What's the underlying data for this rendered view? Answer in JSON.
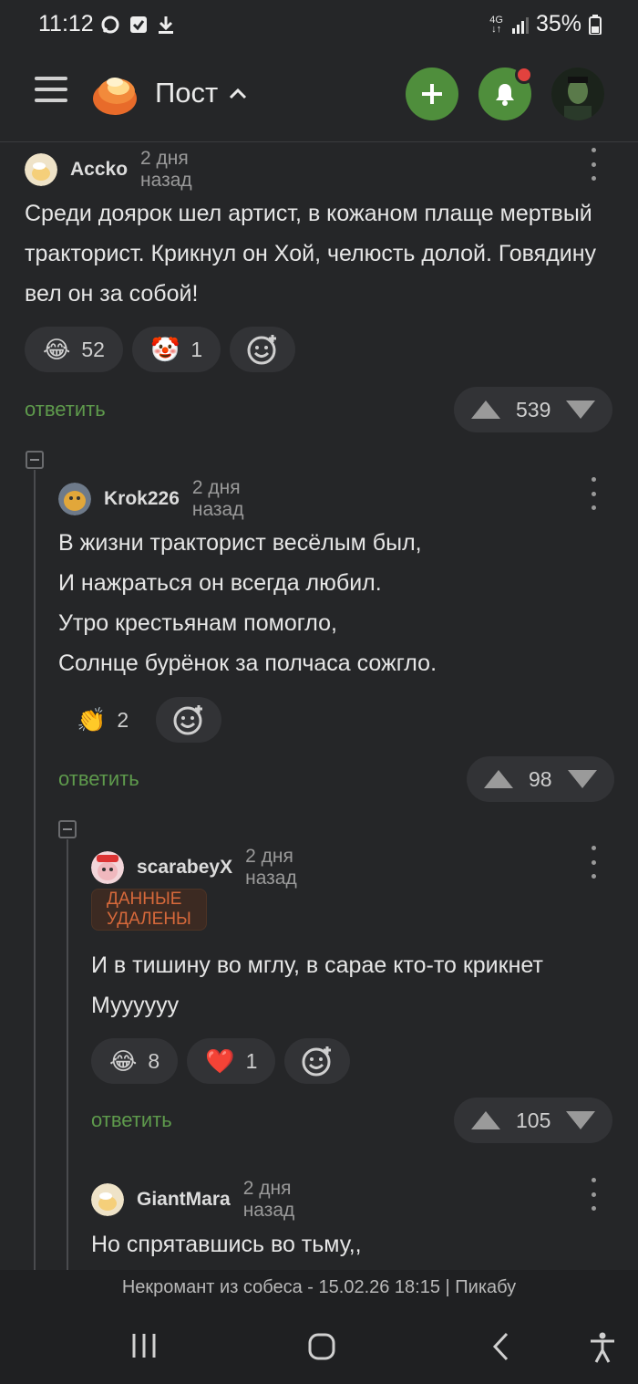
{
  "status_bar": {
    "time": "11:12",
    "network": "4G",
    "battery": "35%"
  },
  "header": {
    "title": "Пост"
  },
  "comments": [
    {
      "user": "Accko",
      "date": "2 дня назад",
      "text": "Среди доярок шел артист, в кожаном плаще мертвый тракторист. Крикнул он Хой, челюсть долой. Говядину вел он за собой!",
      "reactions": [
        {
          "icon": "laughing-face-icon",
          "emoji": "😂",
          "count": "52"
        },
        {
          "icon": "clown-face-icon",
          "emoji": "🤡",
          "count": "1"
        }
      ],
      "reply_label": "ответить",
      "rating": "539"
    },
    {
      "user": "Krok226",
      "date": "2 дня назад",
      "text": "В жизни тракторист весёлым был,\nИ нажраться он всегда любил.\nУтро крестьянам помогло,\nСолнце бурёнок за полчаса сожгло.",
      "reactions": [
        {
          "icon": "clapping-hands-icon",
          "emoji": "👏",
          "count": "2"
        }
      ],
      "reply_label": "ответить",
      "rating": "98"
    },
    {
      "user": "scarabeyX",
      "date": "2 дня назад",
      "badge": "ДАННЫЕ УДАЛЕНЫ",
      "text": "И в тишину во мглу, в сарае кто-то крикнет Муууууу",
      "reactions": [
        {
          "icon": "laughing-face-icon",
          "emoji": "😂",
          "count": "8"
        },
        {
          "icon": "red-heart-icon",
          "emoji": "❤️",
          "count": "1"
        }
      ],
      "reply_label": "ответить",
      "rating": "105"
    },
    {
      "user": "GiantMara",
      "date": "2 дня назад",
      "text": "Но спрятавшись во тьму,,"
    }
  ],
  "footer": {
    "caption": "Некромант из собеса - 15.02.26 18:15 | Пикабу"
  },
  "colors": {
    "accent_green": "#4f8e3c",
    "reply_green": "#5e9a4c",
    "badge_orange": "#d7693b",
    "notification_red": "#e2423e"
  }
}
